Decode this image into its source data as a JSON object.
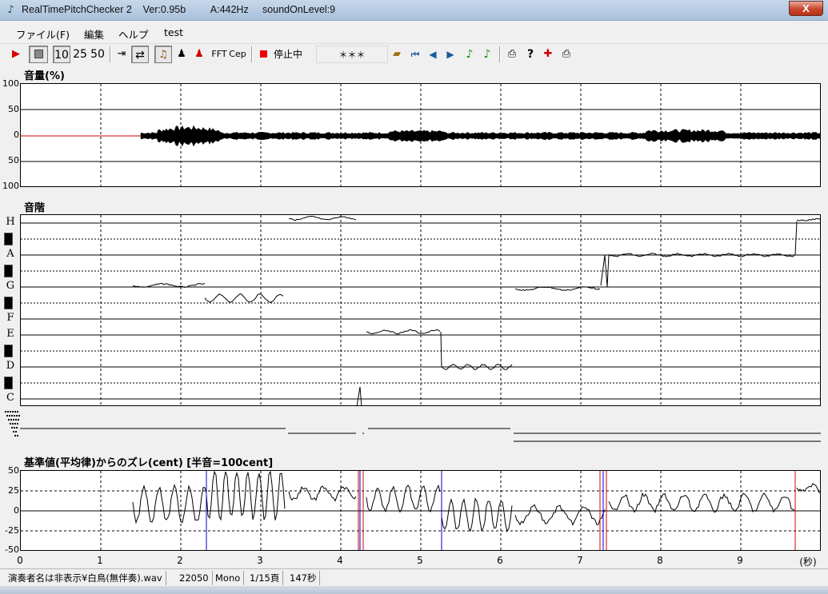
{
  "window": {
    "title": "RealTimePitchChecker 2    Ver:0.95b         A:442Hz     soundOnLevel:9",
    "close_label": "X"
  },
  "menu": [
    "ファイル(F)",
    "編集",
    "ヘルプ",
    "test"
  ],
  "toolbar": {
    "speed_10": "10",
    "speed_25": "25",
    "speed_50": "50",
    "fft_label": "FFT",
    "cep_label": "Cep",
    "status_label": "停止中",
    "display_value": "＊＊＊"
  },
  "volume_panel": {
    "title": "音量(%)",
    "y_ticks": [
      "100",
      "50",
      "0",
      "50",
      "100"
    ]
  },
  "scale_panel": {
    "title": "音階",
    "notes": [
      "H",
      "A",
      "G",
      "F",
      "E",
      "D",
      "C"
    ]
  },
  "deviation_panel": {
    "title": "基準値(平均律)からのズレ(cent) [半音=100cent]",
    "y_ticks": [
      "50",
      "25",
      "0",
      "-25",
      "-50"
    ]
  },
  "x_axis": {
    "ticks": [
      "0",
      "1",
      "2",
      "3",
      "4",
      "5",
      "6",
      "7",
      "8",
      "9"
    ],
    "unit": "(秒)"
  },
  "statusbar": {
    "file": "演奏者名は非表示¥白鳥(無伴奏).wav",
    "rate": "22050",
    "channels": "Mono",
    "page": "1/15頁",
    "length": "147秒"
  },
  "chart_data": {
    "type": "line",
    "x_range": [
      0,
      10
    ],
    "volume": {
      "ylim": [
        -100,
        100
      ]
    },
    "pitch_segments": [
      {
        "start": 1.4,
        "end": 3.3,
        "notes": [
          "G",
          "F#"
        ]
      },
      {
        "start": 3.35,
        "end": 4.2,
        "notes": [
          "H"
        ]
      },
      {
        "start": 4.3,
        "end": 6.15,
        "notes": [
          "E",
          "D"
        ]
      },
      {
        "start": 6.2,
        "end": 10,
        "notes": [
          "G",
          "A",
          "H"
        ]
      }
    ],
    "deviation": {
      "ylim": [
        -50,
        50
      ]
    }
  }
}
